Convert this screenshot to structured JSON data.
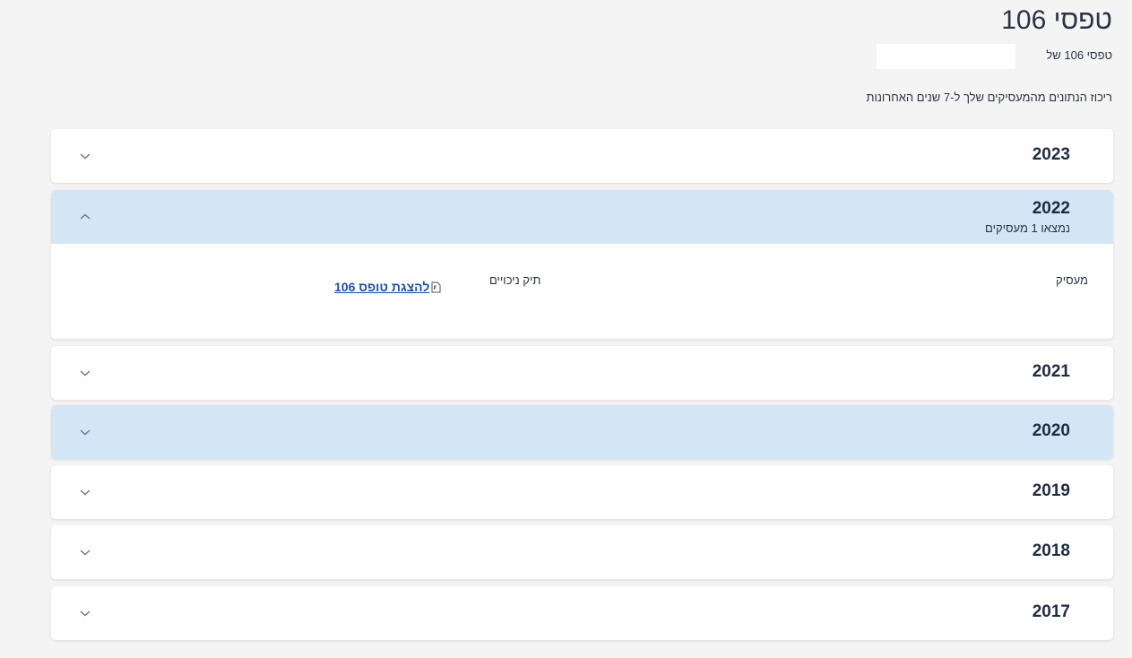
{
  "header": {
    "title": "טפסי 106",
    "subtitle": "טפסי 106 של",
    "summary": "ריכוז הנתונים מהמעסיקים שלך ל-7 שנים האחרונות"
  },
  "accordion": [
    {
      "year": "2023",
      "expanded": false,
      "highlighted": false
    },
    {
      "year": "2022",
      "expanded": true,
      "highlighted": true,
      "count_text": "נמצאו 1 מעסיקים",
      "body": {
        "employer_header": "מעסיק",
        "deductions_header": "תיק ניכויים",
        "form_link_label": "להצגת טופס 106",
        "form_link_icon": "document-icon"
      }
    },
    {
      "year": "2021",
      "expanded": false,
      "highlighted": false
    },
    {
      "year": "2020",
      "expanded": false,
      "highlighted": true
    },
    {
      "year": "2019",
      "expanded": false,
      "highlighted": false
    },
    {
      "year": "2018",
      "expanded": false,
      "highlighted": false
    },
    {
      "year": "2017",
      "expanded": false,
      "highlighted": false
    }
  ],
  "colors": {
    "background": "#f4f4f4",
    "highlight": "#d3e6f5",
    "link": "#1a4fb5",
    "year_text": "#1d2b45"
  }
}
